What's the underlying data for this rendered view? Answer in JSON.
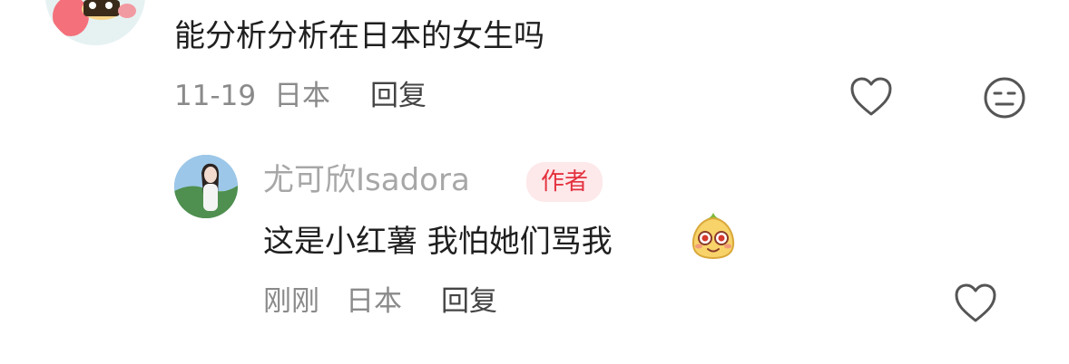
{
  "top_comment": {
    "text": "能分析分析在日本的女生吗",
    "date": "11-19",
    "location": "日本",
    "reply_label": "回复",
    "like_icon": "heart-outline-icon",
    "dislike_icon": "meh-face-icon",
    "avatar_icon": "cartoon-avatar"
  },
  "reply_comment": {
    "author": "尤可欣Isadora",
    "badge": "作者",
    "text": "这是小红薯 我怕她们骂我",
    "emoji_icon": "red-potato-emoji-icon",
    "time": "刚刚",
    "location": "日本",
    "reply_label": "回复",
    "like_icon": "heart-outline-icon",
    "avatar_icon": "photo-avatar"
  },
  "colors": {
    "badge_bg": "#fde8ea",
    "badge_text": "#e4323f",
    "meta_text": "#8a8a8a",
    "author_text": "#a7a7a7",
    "body_text": "#1f1f1f"
  }
}
